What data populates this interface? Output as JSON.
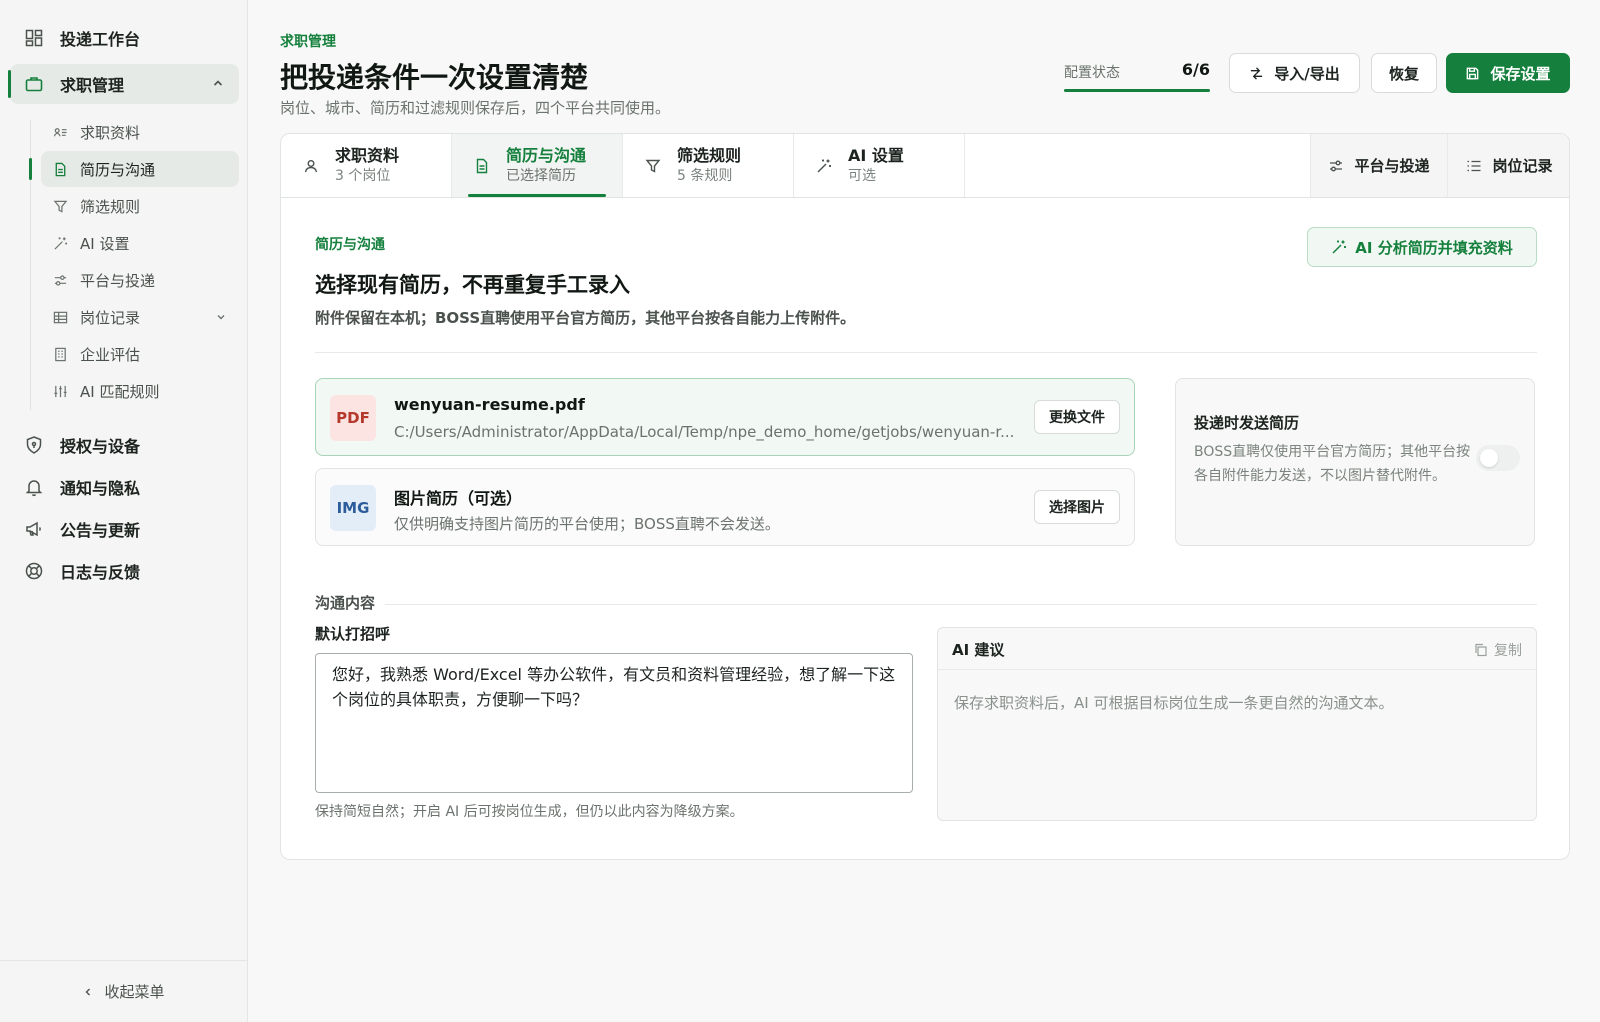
{
  "sidebar": {
    "items": [
      {
        "label": "投递工作台",
        "icon": "dashboard-icon"
      },
      {
        "label": "求职管理",
        "icon": "briefcase-icon"
      },
      {
        "label": "授权与设备",
        "icon": "shield-icon"
      },
      {
        "label": "通知与隐私",
        "icon": "bell-icon"
      },
      {
        "label": "公告与更新",
        "icon": "megaphone-icon"
      },
      {
        "label": "日志与反馈",
        "icon": "lifebuoy-icon"
      }
    ],
    "sub_items": [
      {
        "label": "求职资料",
        "icon": "id-card-icon"
      },
      {
        "label": "简历与沟通",
        "icon": "document-icon"
      },
      {
        "label": "筛选规则",
        "icon": "filter-icon"
      },
      {
        "label": "AI 设置",
        "icon": "magic-wand-icon"
      },
      {
        "label": "平台与投递",
        "icon": "sliders-icon"
      },
      {
        "label": "岗位记录",
        "icon": "table-icon"
      },
      {
        "label": "企业评估",
        "icon": "building-icon"
      },
      {
        "label": "AI 匹配规则",
        "icon": "tune-icon"
      }
    ],
    "collapse_label": "收起菜单"
  },
  "header": {
    "eyebrow": "求职管理",
    "title": "把投递条件一次设置清楚",
    "subtitle": "岗位、城市、简历和过滤规则保存后，四个平台共同使用。",
    "config_label": "配置状态",
    "config_value": "6/6",
    "config_progress": 1.0,
    "import_export_label": "导入/导出",
    "restore_label": "恢复",
    "save_label": "保存设置"
  },
  "tabs": [
    {
      "title": "求职资料",
      "sub": "3 个岗位",
      "icon": "user-icon"
    },
    {
      "title": "简历与沟通",
      "sub": "已选择简历",
      "icon": "document-icon"
    },
    {
      "title": "筛选规则",
      "sub": "5 条规则",
      "icon": "filter-icon"
    },
    {
      "title": "AI 设置",
      "sub": "可选",
      "icon": "magic-wand-icon"
    }
  ],
  "tab_links": [
    {
      "label": "平台与投递",
      "icon": "sliders-icon"
    },
    {
      "label": "岗位记录",
      "icon": "list-icon"
    }
  ],
  "section": {
    "eyebrow": "简历与沟通",
    "title": "选择现有简历，不再重复手工录入",
    "subtitle": "附件保留在本机；BOSS直聘使用平台官方简历，其他平台按各自能力上传附件。",
    "ai_fill_label": "AI 分析简历并填充资料"
  },
  "files": {
    "pdf": {
      "type": "PDF",
      "name": "wenyuan-resume.pdf",
      "path": "C:/Users/Administrator/AppData/Local/Temp/npe_demo_home/getjobs/wenyuan-r...",
      "button": "更换文件"
    },
    "img": {
      "type": "IMG",
      "name": "图片简历（可选）",
      "desc": "仅供明确支持图片简历的平台使用；BOSS直聘不会发送。",
      "button": "选择图片"
    }
  },
  "send_resume": {
    "title": "投递时发送简历",
    "desc": "BOSS直聘仅使用平台官方简历；其他平台按各自附件能力发送，不以图片替代附件。",
    "enabled": false
  },
  "communication": {
    "section_label": "沟通内容",
    "greeting_label": "默认打招呼",
    "greeting_text": "您好，我熟悉 Word/Excel 等办公软件，有文员和资料管理经验，想了解一下这个岗位的具体职责，方便聊一下吗？",
    "hint": "保持简短自然；开启 AI 后可按岗位生成，但仍以此内容为降级方案。",
    "ai_title": "AI 建议",
    "copy_label": "复制",
    "ai_placeholder": "保存求职资料后，AI 可根据目标岗位生成一条更自然的沟通文本。"
  },
  "colors": {
    "accent": "#15803d",
    "pdf": "#b4382c",
    "img": "#2c5d9a"
  }
}
